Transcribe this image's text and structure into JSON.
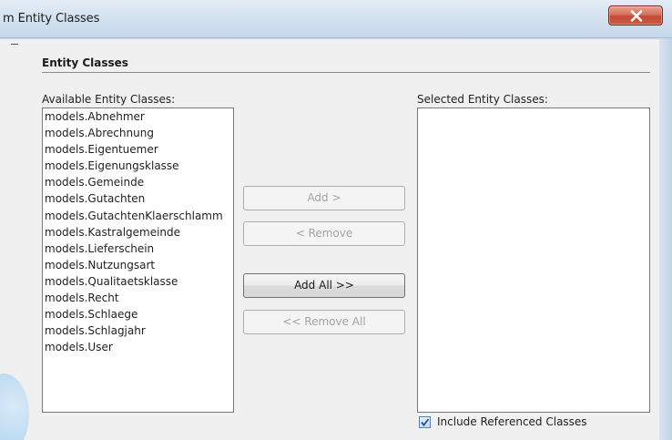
{
  "window": {
    "title": "m Entity Classes",
    "close_icon": "close-icon"
  },
  "group": {
    "title": "Entity Classes"
  },
  "available": {
    "label": "Available Entity Classes:",
    "items": [
      "models.Abnehmer",
      "models.Abrechnung",
      "models.Eigentuemer",
      "models.Eigenungsklasse",
      "models.Gemeinde",
      "models.Gutachten",
      "models.GutachtenKlaerschlamm",
      "models.Kastralgemeinde",
      "models.Lieferschein",
      "models.Nutzungsart",
      "models.Qualitaetsklasse",
      "models.Recht",
      "models.Schlaege",
      "models.Schlagjahr",
      "models.User"
    ]
  },
  "buttons": {
    "add": "Add >",
    "remove": "< Remove",
    "add_all": "Add All >>",
    "remove_all": "<< Remove All"
  },
  "selected": {
    "label": "Selected Entity Classes:",
    "items": []
  },
  "include_referenced": {
    "label": "Include Referenced Classes",
    "checked": true
  },
  "colors": {
    "title_bar": "#d2e0ee",
    "close_button": "#c24a36",
    "dialog_bg": "#f0f0f0"
  }
}
